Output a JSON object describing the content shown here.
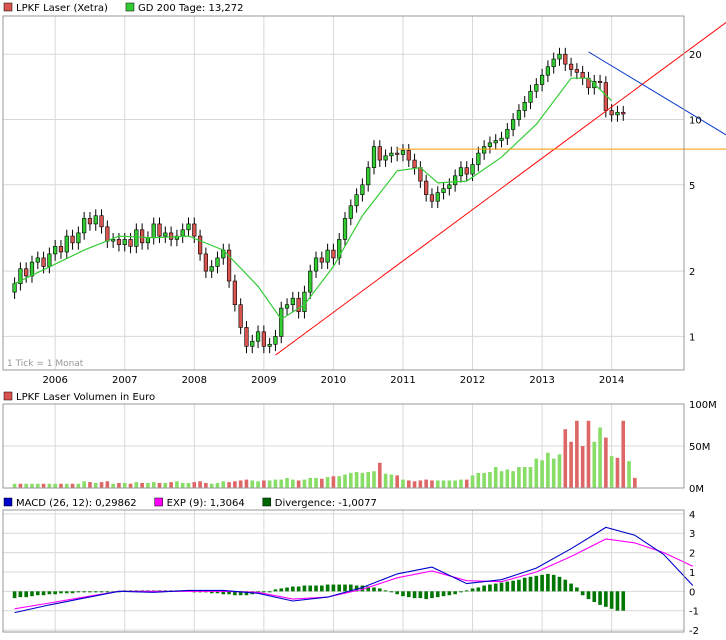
{
  "chart_data": [
    {
      "type": "candlestick",
      "legend": [
        {
          "label": "LPKF Laser (Xetra)",
          "color": "#d9534f"
        },
        {
          "label": "GD 200 Tage: 13,272",
          "color": "#33cc33"
        }
      ],
      "y_scale": "log",
      "ylim": [
        0.7,
        30
      ],
      "y_ticks": [
        {
          "v": 1,
          "label": "1"
        },
        {
          "v": 2,
          "label": "2"
        },
        {
          "v": 5,
          "label": "5"
        },
        {
          "v": 10,
          "label": "10"
        },
        {
          "v": 20,
          "label": "20"
        }
      ],
      "x_labels": [
        "2006",
        "2007",
        "2008",
        "2009",
        "2010",
        "2011",
        "2012",
        "2013",
        "2014"
      ],
      "x_range": [
        2005.25,
        2015.04
      ],
      "note": "1 Tick = 1 Monat",
      "candles": [
        [
          1.6,
          1.75
        ],
        [
          1.75,
          2.05
        ],
        [
          2.05,
          1.9
        ],
        [
          1.9,
          2.2
        ],
        [
          2.2,
          2.3
        ],
        [
          2.3,
          2.1
        ],
        [
          2.1,
          2.4
        ],
        [
          2.4,
          2.6
        ],
        [
          2.6,
          2.45
        ],
        [
          2.45,
          2.9
        ],
        [
          2.9,
          2.7
        ],
        [
          2.7,
          3.0
        ],
        [
          3.0,
          3.5
        ],
        [
          3.5,
          3.3
        ],
        [
          3.3,
          3.6
        ],
        [
          3.6,
          3.2
        ],
        [
          3.2,
          2.75
        ],
        [
          2.75,
          2.8
        ],
        [
          2.8,
          2.65
        ],
        [
          2.65,
          2.8
        ],
        [
          2.8,
          2.6
        ],
        [
          2.6,
          3.1
        ],
        [
          3.1,
          2.7
        ],
        [
          2.7,
          2.85
        ],
        [
          2.85,
          3.3
        ],
        [
          3.3,
          2.9
        ],
        [
          2.9,
          3.0
        ],
        [
          3.0,
          2.8
        ],
        [
          2.8,
          2.9
        ],
        [
          2.9,
          3.1
        ],
        [
          3.1,
          3.3
        ],
        [
          3.3,
          2.9
        ],
        [
          2.9,
          2.4
        ],
        [
          2.4,
          2.0
        ],
        [
          2.0,
          2.1
        ],
        [
          2.1,
          2.3
        ],
        [
          2.3,
          2.5
        ],
        [
          2.5,
          1.8
        ],
        [
          1.8,
          1.4
        ],
        [
          1.4,
          1.1
        ],
        [
          1.1,
          0.9
        ],
        [
          0.9,
          0.95
        ],
        [
          0.95,
          1.05
        ],
        [
          1.05,
          0.9
        ],
        [
          0.9,
          0.92
        ],
        [
          0.92,
          1.0
        ],
        [
          1.0,
          1.35
        ],
        [
          1.35,
          1.4
        ],
        [
          1.4,
          1.5
        ],
        [
          1.5,
          1.3
        ],
        [
          1.3,
          1.6
        ],
        [
          1.6,
          2.0
        ],
        [
          2.0,
          2.3
        ],
        [
          2.3,
          2.2
        ],
        [
          2.2,
          2.5
        ],
        [
          2.5,
          2.3
        ],
        [
          2.3,
          2.8
        ],
        [
          2.8,
          3.5
        ],
        [
          3.5,
          4.0
        ],
        [
          4.0,
          4.5
        ],
        [
          4.5,
          5.0
        ],
        [
          5.0,
          6.0
        ],
        [
          6.0,
          7.5
        ],
        [
          7.5,
          6.5
        ],
        [
          6.5,
          6.8
        ],
        [
          6.8,
          7.0
        ],
        [
          7.0,
          6.9
        ],
        [
          6.9,
          7.2
        ],
        [
          7.2,
          6.5
        ],
        [
          6.5,
          6.0
        ],
        [
          6.0,
          5.2
        ],
        [
          5.2,
          4.5
        ],
        [
          4.5,
          4.2
        ],
        [
          4.2,
          4.6
        ],
        [
          4.6,
          4.8
        ],
        [
          4.8,
          5.0
        ],
        [
          5.0,
          5.5
        ],
        [
          5.5,
          6.0
        ],
        [
          6.0,
          5.6
        ],
        [
          5.6,
          6.2
        ],
        [
          6.2,
          7.0
        ],
        [
          7.0,
          7.5
        ],
        [
          7.5,
          7.8
        ],
        [
          7.8,
          8.0
        ],
        [
          8.0,
          8.2
        ],
        [
          8.2,
          9.0
        ],
        [
          9.0,
          10.0
        ],
        [
          10.0,
          11.0
        ],
        [
          11.0,
          12.0
        ],
        [
          12.0,
          13.5
        ],
        [
          13.5,
          14.5
        ],
        [
          14.5,
          16.0
        ],
        [
          16.0,
          17.5
        ],
        [
          17.5,
          19.0
        ],
        [
          19.0,
          20.0
        ],
        [
          20.0,
          18.0
        ],
        [
          18.0,
          17.0
        ],
        [
          17.0,
          16.5
        ],
        [
          16.5,
          15.5
        ],
        [
          15.5,
          14.0
        ],
        [
          14.0,
          15.0
        ],
        [
          15.0,
          14.8
        ],
        [
          14.8,
          11.0
        ],
        [
          11.0,
          10.5
        ],
        [
          10.5,
          10.8
        ],
        [
          10.8,
          10.6
        ]
      ],
      "gd200": [
        [
          0,
          1.75
        ],
        [
          12,
          2.5
        ],
        [
          18,
          2.9
        ],
        [
          24,
          2.85
        ],
        [
          30,
          2.9
        ],
        [
          36,
          2.5
        ],
        [
          42,
          1.7
        ],
        [
          46,
          1.2
        ],
        [
          50,
          1.4
        ],
        [
          55,
          2.1
        ],
        [
          60,
          3.6
        ],
        [
          66,
          5.8
        ],
        [
          70,
          6.0
        ],
        [
          73,
          5.1
        ],
        [
          78,
          5.2
        ],
        [
          84,
          6.7
        ],
        [
          90,
          9.5
        ],
        [
          96,
          15.5
        ],
        [
          99,
          15.5
        ],
        [
          103,
          12.2
        ]
      ]
    },
    {
      "type": "bar",
      "legend": [
        {
          "label": "LPKF Laser Volumen in Euro",
          "color": "#d9534f"
        }
      ],
      "y_unit": "M",
      "ylim": [
        0,
        100
      ],
      "y_ticks": [
        {
          "v": 0,
          "label": "0M"
        },
        {
          "v": 50,
          "label": "50M"
        },
        {
          "v": 100,
          "label": "100M"
        }
      ],
      "values": [
        5,
        5,
        5,
        5,
        5,
        5,
        5,
        5,
        5,
        5,
        5,
        5,
        8,
        7,
        6,
        7,
        8,
        5,
        6,
        6,
        5,
        7,
        6,
        6,
        7,
        6,
        6,
        7,
        8,
        6,
        6,
        7,
        8,
        6,
        5,
        6,
        8,
        7,
        8,
        9,
        10,
        9,
        8,
        9,
        9,
        10,
        10,
        12,
        10,
        9,
        10,
        12,
        12,
        11,
        13,
        14,
        14,
        16,
        18,
        19,
        18,
        19,
        20,
        30,
        17,
        16,
        15,
        10,
        9,
        8,
        9,
        10,
        9,
        9,
        9,
        9,
        9,
        10,
        10,
        15,
        18,
        18,
        19,
        25,
        20,
        22,
        20,
        25,
        25,
        25,
        35,
        33,
        42,
        35,
        40,
        70,
        55,
        80,
        50,
        80,
        55,
        72,
        60,
        38,
        36,
        80,
        32,
        12
      ],
      "direction": [
        1,
        -1,
        1,
        1,
        1,
        -1,
        1,
        1,
        -1,
        1,
        -1,
        1,
        1,
        -1,
        1,
        -1,
        -1,
        1,
        -1,
        1,
        -1,
        1,
        -1,
        1,
        1,
        -1,
        1,
        -1,
        1,
        1,
        1,
        -1,
        -1,
        -1,
        1,
        1,
        1,
        -1,
        -1,
        -1,
        -1,
        1,
        1,
        -1,
        1,
        1,
        1,
        1,
        1,
        -1,
        1,
        1,
        1,
        -1,
        1,
        -1,
        1,
        1,
        1,
        1,
        1,
        1,
        1,
        -1,
        1,
        1,
        -1,
        1,
        -1,
        -1,
        -1,
        -1,
        -1,
        1,
        1,
        1,
        1,
        1,
        -1,
        1,
        1,
        1,
        1,
        1,
        1,
        1,
        1,
        1,
        1,
        1,
        1,
        1,
        1,
        1,
        1,
        -1,
        -1,
        -1,
        -1,
        -1,
        1,
        1,
        -1,
        1,
        -1,
        -1,
        1,
        -1
      ]
    },
    {
      "type": "macd",
      "legend": [
        {
          "label": "MACD (26, 12): 0,29862",
          "color": "#0000cc"
        },
        {
          "label": "EXP (9): 1,3064",
          "color": "#ff00ff"
        },
        {
          "label": "Divergence: -1,0077",
          "color": "#006600"
        }
      ],
      "ylim": [
        -2.1,
        4.2
      ],
      "y_ticks": [
        {
          "v": -2,
          "label": "-2"
        },
        {
          "v": -1,
          "label": "-1"
        },
        {
          "v": 0,
          "label": "0"
        },
        {
          "v": 1,
          "label": "1"
        },
        {
          "v": 2,
          "label": "2"
        },
        {
          "v": 3,
          "label": "3"
        },
        {
          "v": 4,
          "label": "4"
        }
      ],
      "macd": [
        [
          0,
          -1.1
        ],
        [
          6,
          -0.7
        ],
        [
          12,
          -0.35
        ],
        [
          18,
          0
        ],
        [
          24,
          -0.05
        ],
        [
          30,
          0.05
        ],
        [
          36,
          0.05
        ],
        [
          42,
          -0.1
        ],
        [
          48,
          -0.5
        ],
        [
          54,
          -0.3
        ],
        [
          60,
          0.2
        ],
        [
          66,
          0.9
        ],
        [
          72,
          1.25
        ],
        [
          78,
          0.4
        ],
        [
          84,
          0.6
        ],
        [
          90,
          1.2
        ],
        [
          96,
          2.2
        ],
        [
          102,
          3.3
        ],
        [
          107,
          2.9
        ],
        [
          112,
          1.9
        ],
        [
          117,
          0.3
        ]
      ],
      "exp": [
        [
          0,
          -0.9
        ],
        [
          6,
          -0.6
        ],
        [
          12,
          -0.3
        ],
        [
          18,
          0
        ],
        [
          24,
          0
        ],
        [
          30,
          0
        ],
        [
          36,
          0
        ],
        [
          42,
          -0.05
        ],
        [
          48,
          -0.4
        ],
        [
          54,
          -0.3
        ],
        [
          60,
          0.1
        ],
        [
          66,
          0.7
        ],
        [
          72,
          1.05
        ],
        [
          78,
          0.55
        ],
        [
          84,
          0.5
        ],
        [
          90,
          1.0
        ],
        [
          96,
          1.8
        ],
        [
          102,
          2.7
        ],
        [
          107,
          2.5
        ],
        [
          112,
          2.0
        ],
        [
          117,
          1.3
        ]
      ],
      "divergence": [
        -0.35,
        -0.3,
        -0.3,
        -0.25,
        -0.2,
        -0.2,
        -0.15,
        -0.15,
        -0.1,
        -0.1,
        -0.1,
        -0.05,
        -0.05,
        -0.05,
        0,
        0,
        0,
        0,
        0,
        0.05,
        0.05,
        0.05,
        0.05,
        0.05,
        0.05,
        0.05,
        0.05,
        0.05,
        0.05,
        0.05,
        0.05,
        0,
        0,
        -0.05,
        -0.1,
        -0.1,
        -0.15,
        -0.15,
        -0.2,
        -0.2,
        -0.2,
        -0.15,
        -0.1,
        -0.05,
        0,
        0.1,
        0.15,
        0.2,
        0.25,
        0.25,
        0.3,
        0.3,
        0.3,
        0.3,
        0.35,
        0.35,
        0.35,
        0.35,
        0.35,
        0.3,
        0.3,
        0.25,
        0.2,
        0.15,
        0.05,
        -0.05,
        -0.15,
        -0.25,
        -0.3,
        -0.35,
        -0.35,
        -0.4,
        -0.35,
        -0.3,
        -0.25,
        -0.2,
        -0.15,
        -0.05,
        0.05,
        0.15,
        0.2,
        0.3,
        0.35,
        0.4,
        0.45,
        0.5,
        0.55,
        0.6,
        0.7,
        0.75,
        0.8,
        0.85,
        0.9,
        0.85,
        0.75,
        0.6,
        0.4,
        0.2,
        -0.2,
        -0.4,
        -0.55,
        -0.7,
        -0.8,
        -0.9,
        -1.0,
        -1.0
      ]
    }
  ]
}
